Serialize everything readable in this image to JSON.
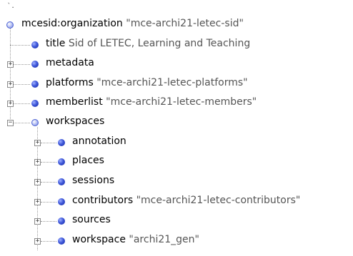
{
  "tree": {
    "root": {
      "name": "mcesid:organization",
      "value": "\"mce-archi21-letec-sid\""
    },
    "children": [
      {
        "name": "title",
        "value": "Sid of LETEC, Learning and Teaching",
        "expander": ""
      },
      {
        "name": "metadata",
        "value": "",
        "expander": "+"
      },
      {
        "name": "platforms",
        "value": "\"mce-archi21-letec-platforms\"",
        "expander": "+"
      },
      {
        "name": "memberlist",
        "value": "\"mce-archi21-letec-members\"",
        "expander": "+"
      },
      {
        "name": "workspaces",
        "value": "",
        "expander": "−"
      }
    ],
    "workspace_children": [
      {
        "name": "annotation",
        "value": "",
        "expander": "+"
      },
      {
        "name": "places",
        "value": "",
        "expander": "+"
      },
      {
        "name": "sessions",
        "value": "",
        "expander": "+"
      },
      {
        "name": "contributors",
        "value": "\"mce-archi21-letec-contributors\"",
        "expander": "+"
      },
      {
        "name": "sources",
        "value": "",
        "expander": "+"
      },
      {
        "name": "workspace",
        "value": "\"archi21_gen\"",
        "expander": "+"
      }
    ]
  }
}
